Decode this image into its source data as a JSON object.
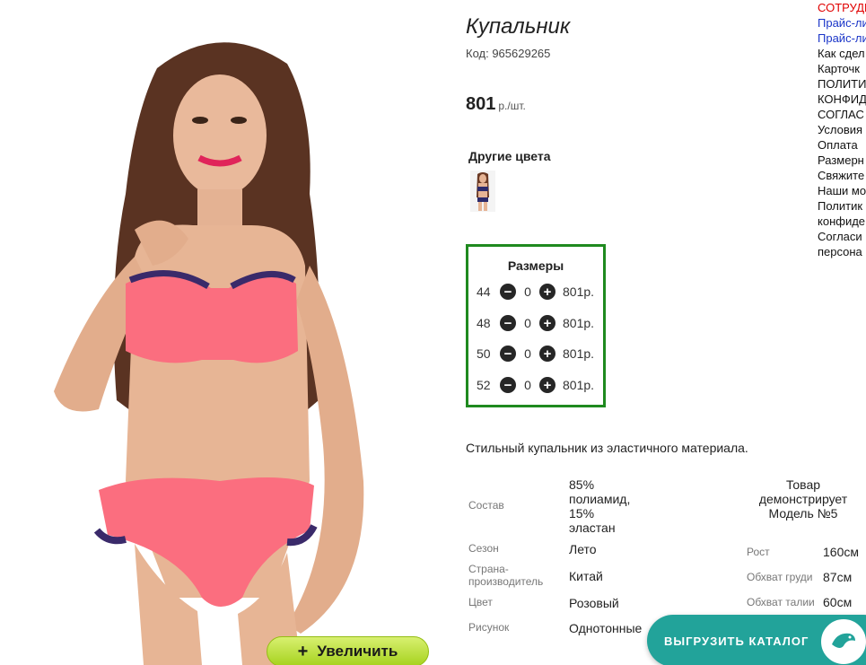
{
  "product": {
    "title": "Купальник",
    "code": "Код: 965629265",
    "price": "801",
    "price_unit": "р./шт.",
    "zoom_label": "Увеличить",
    "zoom_plus": "+",
    "image_icon": "product-photo"
  },
  "other_colors": {
    "heading": "Другие цвета",
    "thumb_icon": "color-thumbnail"
  },
  "sizes": {
    "heading": "Размеры",
    "rows": [
      {
        "size": "44",
        "qty": "0",
        "price": "801р."
      },
      {
        "size": "48",
        "qty": "0",
        "price": "801р."
      },
      {
        "size": "50",
        "qty": "0",
        "price": "801р."
      },
      {
        "size": "52",
        "qty": "0",
        "price": "801р."
      }
    ],
    "minus_icon": "minus-circle-icon",
    "plus_icon": "plus-circle-icon"
  },
  "description": "Стильный купальник из эластичного материала.",
  "attributes": [
    {
      "label": "Состав",
      "value": [
        "85%",
        "полиамид,",
        "15%",
        "эластан"
      ]
    },
    {
      "label": "Сезон",
      "value": [
        "Лето"
      ]
    },
    {
      "label": "Страна-\nпроизводитель",
      "value": [
        "Китай"
      ]
    },
    {
      "label": "Цвет",
      "value": [
        "Розовый"
      ]
    },
    {
      "label": "Рисунок",
      "value": [
        "Однотонные"
      ]
    }
  ],
  "model": {
    "heading": [
      "Товар",
      "демонстрирует",
      "Модель №5"
    ],
    "measurements": [
      {
        "label": "Рост",
        "value": "160см"
      },
      {
        "label": "Обхват груди",
        "value": "87см"
      },
      {
        "label": "Обхват талии",
        "value": "60см"
      }
    ]
  },
  "menu": [
    {
      "text": "СОТРУДН",
      "color": "red"
    },
    {
      "text": "Прайс-ли",
      "color": "blue"
    },
    {
      "text": "Прайс-ли",
      "color": "blue"
    },
    {
      "text": "Как сдел",
      "color": "black"
    },
    {
      "text": "Карточк",
      "color": "black"
    },
    {
      "text": "ПОЛИТИ",
      "color": "black"
    },
    {
      "text": "КОНФИД",
      "color": "black"
    },
    {
      "text": "СОГЛАС",
      "color": "black"
    },
    {
      "text": "Условия",
      "color": "black"
    },
    {
      "text": "Оплата",
      "color": "black"
    },
    {
      "text": "Размерн",
      "color": "black"
    },
    {
      "text": "Свяжите",
      "color": "black"
    },
    {
      "text": "Наши мо",
      "color": "black"
    },
    {
      "text": "Политик",
      "color": "black"
    },
    {
      "text": "конфиде",
      "color": "black"
    },
    {
      "text": "Согласи",
      "color": "black"
    },
    {
      "text": "персона",
      "color": "black"
    }
  ],
  "export": {
    "label": "ВЫГРУЗИТЬ КАТАЛОГ",
    "icon": "catalog-logo-icon"
  },
  "colors": {
    "accent_green": "#1f8a1f",
    "zoom_green": "#a6d21e",
    "export_teal": "#22a39a",
    "menu_red": "#e00000",
    "menu_blue": "#1a35c8"
  }
}
